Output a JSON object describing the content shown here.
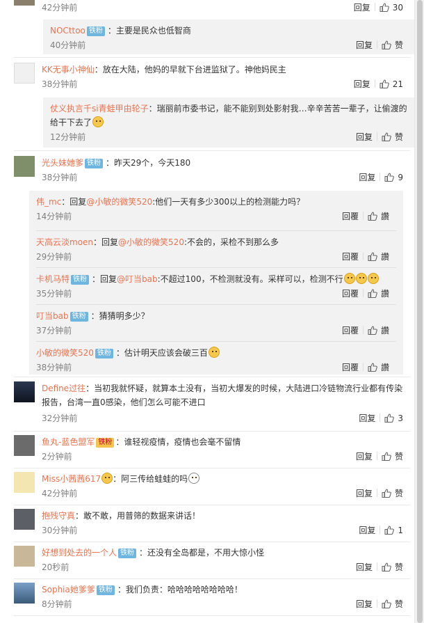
{
  "labels": {
    "reply": "回复",
    "reply_alt": "回覆",
    "like": "赞",
    "like_alt": "讚"
  },
  "top": {
    "time": "42分钟前",
    "likes": "30"
  },
  "c0": {
    "name": "NOCttoo",
    "badge": "铁粉",
    "text": "：主要是民众也低智商",
    "time": "40分钟前"
  },
  "c1": {
    "name": "KK无事小神仙",
    "text": "：放在大陆，他妈的早就下台进监狱了。神他妈民主",
    "time": "38分钟前",
    "likes": "21",
    "sub": {
      "name": "仗义执言千si青蛙甲由轮子",
      "text": "：瑞丽前市委书记，能不能别到处影射我…辛辛苦苦一辈子，让偷渡的给干下去了",
      "time": "12分钟前"
    }
  },
  "c2": {
    "name": "光头妹她爹",
    "badge": "铁粉",
    "text": "：昨天29个，今天180",
    "time": "38分钟前",
    "likes": "9",
    "replies": [
      {
        "name": "伟_mc",
        "pre": "：回复",
        "mention": "@小敏的微笑520",
        "text": ":他们一天有多少300以上的检测能力吗？",
        "time": "14分钟前"
      },
      {
        "name": "天高云淡moen",
        "pre": "：回复",
        "mention": "@小敏的微笑520",
        "text": ":不会的，采检不到那么多",
        "time": "29分钟前"
      },
      {
        "name": "卡机马特",
        "badge": "铁粉",
        "pre": "：回复",
        "mention": "@叮当bab",
        "text": ":不超过100，不检测就没有。采样可以，检测不行",
        "time": "35分钟前"
      },
      {
        "name": "叮当bab",
        "badge": "铁粉",
        "pre": "",
        "mention": "",
        "text": "：猜猜明多少？",
        "time": "37分钟前"
      },
      {
        "name": "小敏的微笑520",
        "badge": "铁粉",
        "pre": "",
        "mention": "",
        "text": "：估计明天应该会破三百",
        "time": "38分钟前"
      }
    ]
  },
  "c3": {
    "name": "Define过往",
    "text": "：当初我就怀疑，就算本土没有，当初大爆发的时候，大陆进口冷链物流行业都有传染报告，台湾一直0感染，他们怎么可能不进口",
    "time": "32分钟前",
    "likes": "3"
  },
  "c4": {
    "name": "鱼丸-蓝色盟军",
    "badge": "铁粉",
    "text": "：谁轻视疫情，疫情也会毫不留情",
    "time": "2分钟前"
  },
  "c5": {
    "name": "Miss小茜茜617",
    "text": "：阿三传给蛙蛙的吗",
    "time": "42分钟前"
  },
  "c6": {
    "name": "抱残守真",
    "text": "：敢不敢，用普筛的数据来讲话！",
    "time": "30分钟前",
    "likes": "1"
  },
  "c7": {
    "name": "好想到处去的一个人",
    "badge": "铁粉",
    "text": "：还没有全岛都是，不用大惊小怪",
    "time": "20秒前"
  },
  "c8": {
    "name": "Sophia她爹爹",
    "badge": "铁粉",
    "text": "：我们负责：哈哈哈哈哈哈哈哈！",
    "time": "8分钟前"
  },
  "colors": {
    "accent": "#eb7350",
    "badge": "#6eb5e0",
    "sub_bg": "#f2f2f2"
  }
}
